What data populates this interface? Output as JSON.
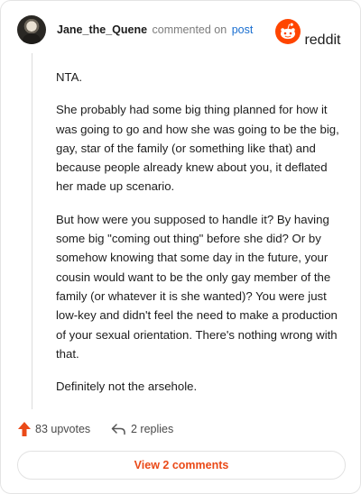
{
  "header": {
    "username": "Jane_the_Quene",
    "action_text": "commented on",
    "post_link": "post",
    "brand": "reddit"
  },
  "comment": {
    "paragraphs": [
      "NTA.",
      "She probably had some big thing planned for how it was going to go and how she was going to be the big, gay, star of the family (or something like that) and because people already knew about you, it deflated her made up scenario.",
      "But how were you supposed to handle it? By having some big \"coming out thing\" before she did? Or by somehow knowing that some day in the future, your cousin would want to be the only gay member of the family (or whatever it is she wanted)? You were just low-key and didn't feel the need to make a production of your sexual orientation. There's nothing wrong with that.",
      "Definitely not the arsehole."
    ]
  },
  "actions": {
    "upvotes": "83 upvotes",
    "replies": "2 replies",
    "view_comments": "View 2 comments"
  },
  "colors": {
    "accent": "#ea4a18",
    "link": "#1a6fd0",
    "brand": "#ff4500"
  }
}
